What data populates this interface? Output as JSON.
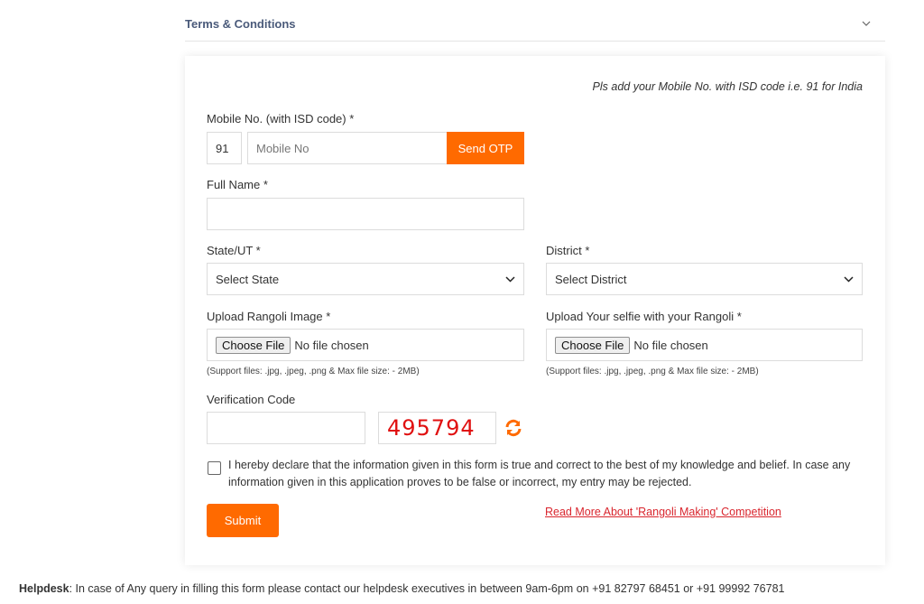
{
  "accordion": {
    "title": "Terms & Conditions",
    "icon": "chevron-down-icon"
  },
  "form": {
    "hint": "Pls add your Mobile No. with ISD code i.e. 91 for India",
    "mobile": {
      "label": "Mobile No. (with ISD code) *",
      "isd_value": "91",
      "placeholder": "Mobile No",
      "send_otp_label": "Send OTP"
    },
    "full_name": {
      "label": "Full Name *",
      "value": ""
    },
    "state": {
      "label": "State/UT *",
      "selected": "Select State"
    },
    "district": {
      "label": "District *",
      "selected": "Select District"
    },
    "upload_rangoli": {
      "label": "Upload Rangoli Image *",
      "button_label": "Choose File",
      "status": "No file chosen",
      "support": "(Support files: .jpg, .jpeg, .png & Max file size: - 2MB)"
    },
    "upload_selfie": {
      "label": "Upload Your selfie with your Rangoli *",
      "button_label": "Choose File",
      "status": "No file chosen",
      "support": "(Support files: .jpg, .jpeg, .png & Max file size: - 2MB)"
    },
    "verification": {
      "label": "Verification Code",
      "value": "",
      "captcha": "495794",
      "refresh_icon": "refresh-icon"
    },
    "declaration": {
      "checked": false,
      "text": "I hereby declare that the information given in this form is true and correct to the best of my knowledge and belief. In case any information given in this application proves to be false or incorrect, my entry may be rejected."
    },
    "submit_label": "Submit",
    "read_more_label": "Read More About 'Rangoli Making' Competition"
  },
  "helpdesk": {
    "label": "Helpdesk",
    "text": ": In case of Any query in filling this form please contact our helpdesk executives in between 9am-6pm on +91 82797 68451 or +91 99992 76781"
  },
  "colors": {
    "accent": "#ff6a00",
    "captcha": "#e01010",
    "link": "#d9262e",
    "accordion_title": "#4a5a7a"
  }
}
